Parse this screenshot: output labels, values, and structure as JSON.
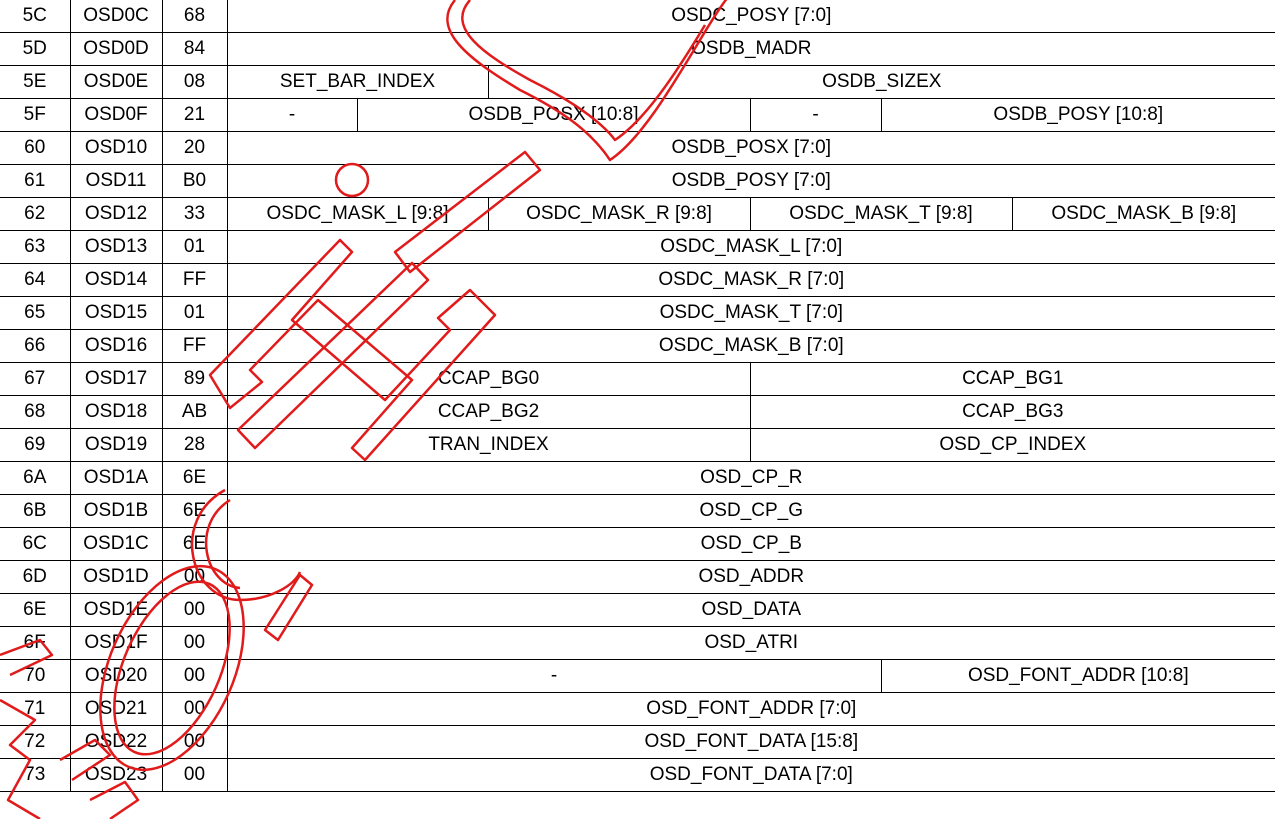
{
  "watermark": {
    "name": "Hi-So stamp",
    "color": "#e11b1b"
  },
  "rows": [
    {
      "index": "5C",
      "name": "OSD0C",
      "default": "68",
      "fields": [
        {
          "label": "OSDC_POSY [7:0]",
          "span": 8
        }
      ]
    },
    {
      "index": "5D",
      "name": "OSD0D",
      "default": "84",
      "fields": [
        {
          "label": "OSDB_MADR",
          "span": 8
        }
      ]
    },
    {
      "index": "5E",
      "name": "OSD0E",
      "default": "08",
      "fields": [
        {
          "label": "SET_BAR_INDEX",
          "span": 2
        },
        {
          "label": "OSDB_SIZEX",
          "span": 6
        }
      ]
    },
    {
      "index": "5F",
      "name": "OSD0F",
      "default": "21",
      "fields": [
        {
          "label": "-",
          "span": 1
        },
        {
          "label": "OSDB_POSX [10:8]",
          "span": 3
        },
        {
          "label": "-",
          "span": 1
        },
        {
          "label": "OSDB_POSY [10:8]",
          "span": 3
        }
      ]
    },
    {
      "index": "60",
      "name": "OSD10",
      "default": "20",
      "fields": [
        {
          "label": "OSDB_POSX [7:0]",
          "span": 8
        }
      ]
    },
    {
      "index": "61",
      "name": "OSD11",
      "default": "B0",
      "fields": [
        {
          "label": "OSDB_POSY [7:0]",
          "span": 8
        }
      ]
    },
    {
      "index": "62",
      "name": "OSD12",
      "default": "33",
      "fields": [
        {
          "label": "OSDC_MASK_L [9:8]",
          "span": 2
        },
        {
          "label": "OSDC_MASK_R [9:8]",
          "span": 2
        },
        {
          "label": "OSDC_MASK_T [9:8]",
          "span": 2
        },
        {
          "label": "OSDC_MASK_B [9:8]",
          "span": 2
        }
      ]
    },
    {
      "index": "63",
      "name": "OSD13",
      "default": "01",
      "fields": [
        {
          "label": "OSDC_MASK_L [7:0]",
          "span": 8
        }
      ]
    },
    {
      "index": "64",
      "name": "OSD14",
      "default": "FF",
      "fields": [
        {
          "label": "OSDC_MASK_R [7:0]",
          "span": 8
        }
      ]
    },
    {
      "index": "65",
      "name": "OSD15",
      "default": "01",
      "fields": [
        {
          "label": "OSDC_MASK_T [7:0]",
          "span": 8
        }
      ]
    },
    {
      "index": "66",
      "name": "OSD16",
      "default": "FF",
      "fields": [
        {
          "label": "OSDC_MASK_B [7:0]",
          "span": 8
        }
      ]
    },
    {
      "index": "67",
      "name": "OSD17",
      "default": "89",
      "fields": [
        {
          "label": "CCAP_BG0",
          "span": 4
        },
        {
          "label": "CCAP_BG1",
          "span": 4
        }
      ]
    },
    {
      "index": "68",
      "name": "OSD18",
      "default": "AB",
      "fields": [
        {
          "label": "CCAP_BG2",
          "span": 4
        },
        {
          "label": "CCAP_BG3",
          "span": 4
        }
      ]
    },
    {
      "index": "69",
      "name": "OSD19",
      "default": "28",
      "fields": [
        {
          "label": "TRAN_INDEX",
          "span": 4
        },
        {
          "label": "OSD_CP_INDEX",
          "span": 4
        }
      ]
    },
    {
      "index": "6A",
      "name": "OSD1A",
      "default": "6E",
      "fields": [
        {
          "label": "OSD_CP_R",
          "span": 8
        }
      ]
    },
    {
      "index": "6B",
      "name": "OSD1B",
      "default": "6E",
      "fields": [
        {
          "label": "OSD_CP_G",
          "span": 8
        }
      ]
    },
    {
      "index": "6C",
      "name": "OSD1C",
      "default": "6E",
      "fields": [
        {
          "label": "OSD_CP_B",
          "span": 8
        }
      ]
    },
    {
      "index": "6D",
      "name": "OSD1D",
      "default": "00",
      "fields": [
        {
          "label": "OSD_ADDR",
          "span": 8
        }
      ]
    },
    {
      "index": "6E",
      "name": "OSD1E",
      "default": "00",
      "fields": [
        {
          "label": "OSD_DATA",
          "span": 8
        }
      ]
    },
    {
      "index": "6F",
      "name": "OSD1F",
      "default": "00",
      "fields": [
        {
          "label": "OSD_ATRI",
          "span": 8
        }
      ]
    },
    {
      "index": "70",
      "name": "OSD20",
      "default": "00",
      "fields": [
        {
          "label": "-",
          "span": 5
        },
        {
          "label": "OSD_FONT_ADDR [10:8]",
          "span": 3
        }
      ]
    },
    {
      "index": "71",
      "name": "OSD21",
      "default": "00",
      "fields": [
        {
          "label": "OSD_FONT_ADDR [7:0]",
          "span": 8
        }
      ]
    },
    {
      "index": "72",
      "name": "OSD22",
      "default": "00",
      "fields": [
        {
          "label": "OSD_FONT_DATA [15:8]",
          "span": 8
        }
      ]
    },
    {
      "index": "73",
      "name": "OSD23",
      "default": "00",
      "fields": [
        {
          "label": "OSD_FONT_DATA [7:0]",
          "span": 8
        }
      ]
    }
  ]
}
